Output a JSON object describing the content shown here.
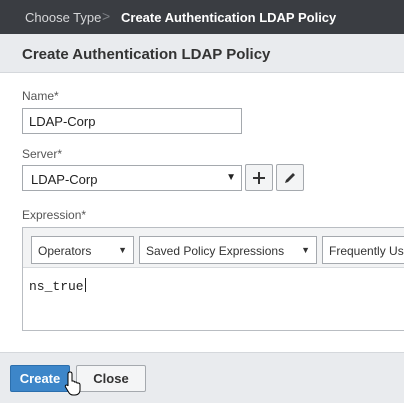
{
  "breadcrumb": {
    "step1": "Choose Type",
    "separator": ">",
    "step2": "Create Authentication LDAP Policy"
  },
  "header": {
    "title": "Create Authentication LDAP Policy"
  },
  "form": {
    "name_label": "Name*",
    "name_value": "LDAP-Corp",
    "server_label": "Server*",
    "server_value": "LDAP-Corp",
    "add_icon": "plus-icon",
    "edit_icon": "pencil-icon",
    "expression_label": "Expression*",
    "expression_dropdowns": [
      "Operators",
      "Saved Policy Expressions",
      "Frequently Use"
    ],
    "expression_value": "ns_true"
  },
  "footer": {
    "create_label": "Create",
    "close_label": "Close"
  },
  "colors": {
    "topbar": "#3a3d42",
    "header": "#e9ebee",
    "primary_button": "#3d86c9"
  }
}
